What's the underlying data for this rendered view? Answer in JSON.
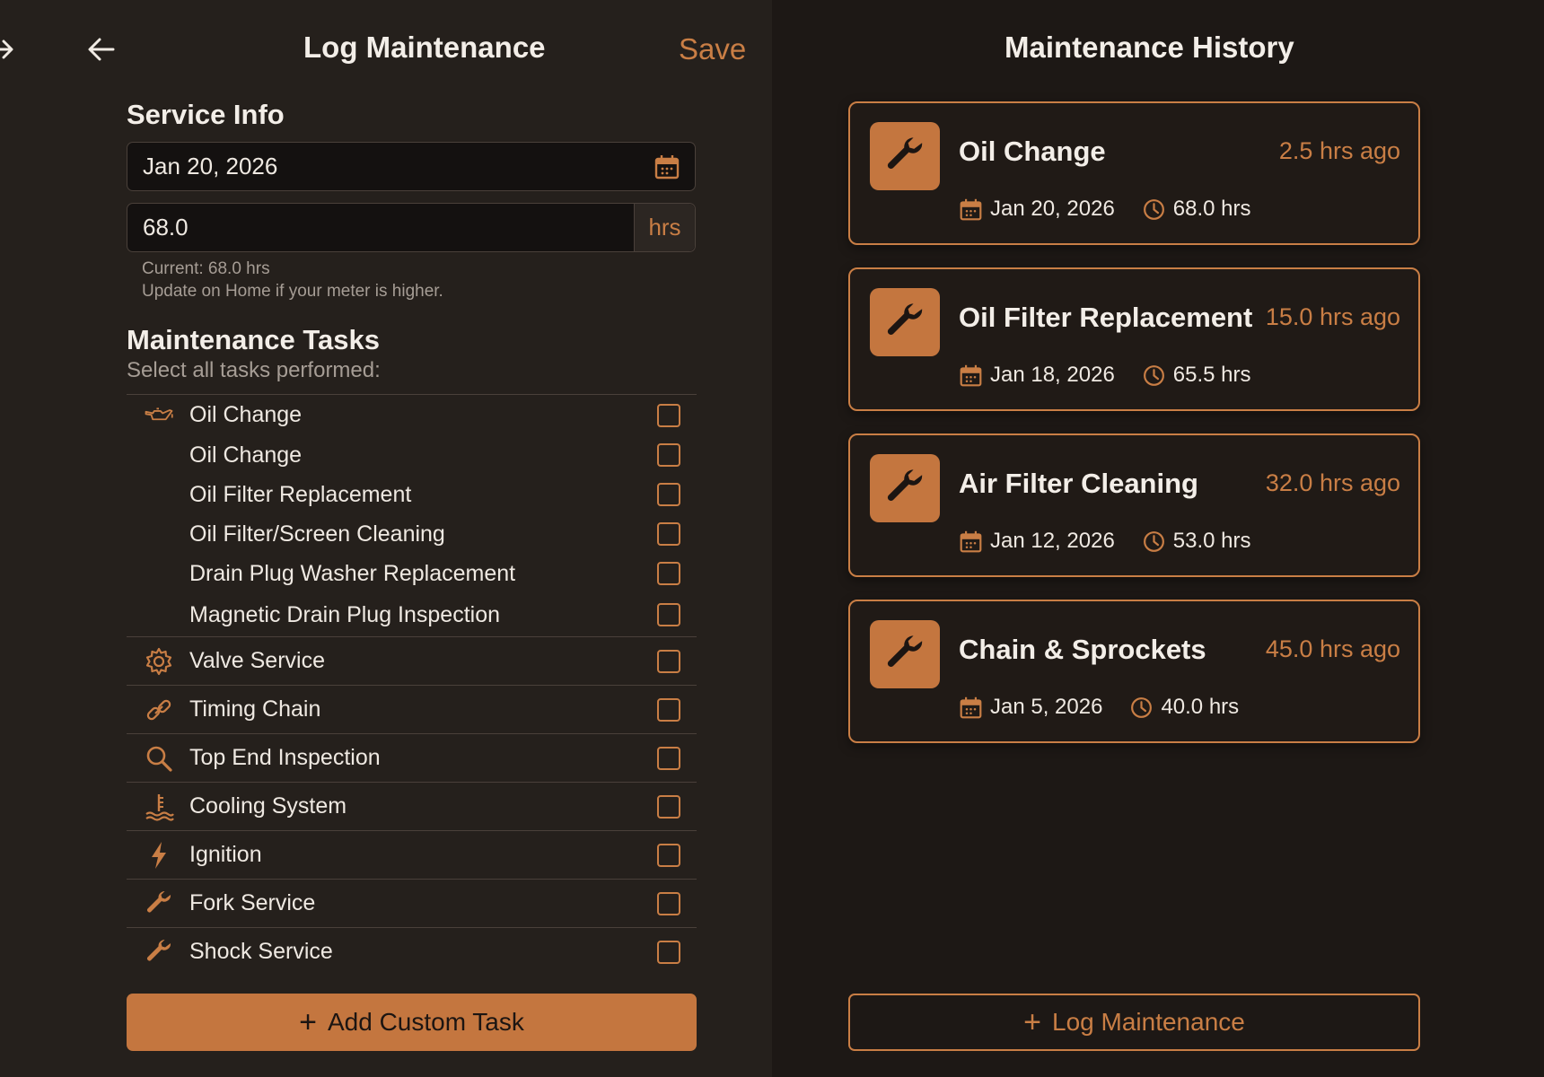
{
  "colors": {
    "accent": "#c97e45",
    "background": "#1c1714",
    "panel": "#25201c",
    "text": "#f1ebe4",
    "muted": "#a69d95"
  },
  "left": {
    "title": "Log Maintenance",
    "save_label": "Save",
    "service_info_heading": "Service Info",
    "date_value": "Jan 20, 2026",
    "hours_value": "68.0",
    "hours_unit": "hrs",
    "hint_current": "Current: 68.0 hrs",
    "hint_update": "Update on Home if your meter is higher.",
    "tasks_heading": "Maintenance Tasks",
    "tasks_sub": "Select all tasks performed:",
    "oil_group": [
      {
        "label": "Oil Change",
        "icon": "oil-can-icon"
      },
      {
        "label": "Oil Change"
      },
      {
        "label": "Oil Filter Replacement"
      },
      {
        "label": "Oil Filter/Screen Cleaning"
      },
      {
        "label": "Drain Plug Washer Replacement"
      },
      {
        "label": "Magnetic Drain Plug Inspection"
      }
    ],
    "tasks": [
      {
        "label": "Valve Service",
        "icon": "gear-icon"
      },
      {
        "label": "Timing Chain",
        "icon": "chain-icon"
      },
      {
        "label": "Top End Inspection",
        "icon": "magnifier-icon"
      },
      {
        "label": "Cooling System",
        "icon": "coolant-icon"
      },
      {
        "label": "Ignition",
        "icon": "lightning-icon"
      },
      {
        "label": "Fork Service",
        "icon": "wrench-icon"
      },
      {
        "label": "Shock Service",
        "icon": "wrench-icon"
      }
    ],
    "add_custom_label": "Add Custom Task"
  },
  "right": {
    "title": "Maintenance History",
    "entries": [
      {
        "title": "Oil Change",
        "ago": "2.5 hrs ago",
        "date": "Jan 20, 2026",
        "hours": "68.0 hrs"
      },
      {
        "title": "Oil Filter Replacement",
        "ago": "15.0 hrs ago",
        "date": "Jan 18, 2026",
        "hours": "65.5 hrs"
      },
      {
        "title": "Air Filter Cleaning",
        "ago": "32.0 hrs ago",
        "date": "Jan 12, 2026",
        "hours": "53.0 hrs"
      },
      {
        "title": "Chain & Sprockets",
        "ago": "45.0 hrs ago",
        "date": "Jan 5, 2026",
        "hours": "40.0 hrs"
      }
    ],
    "log_button_label": "Log Maintenance"
  }
}
